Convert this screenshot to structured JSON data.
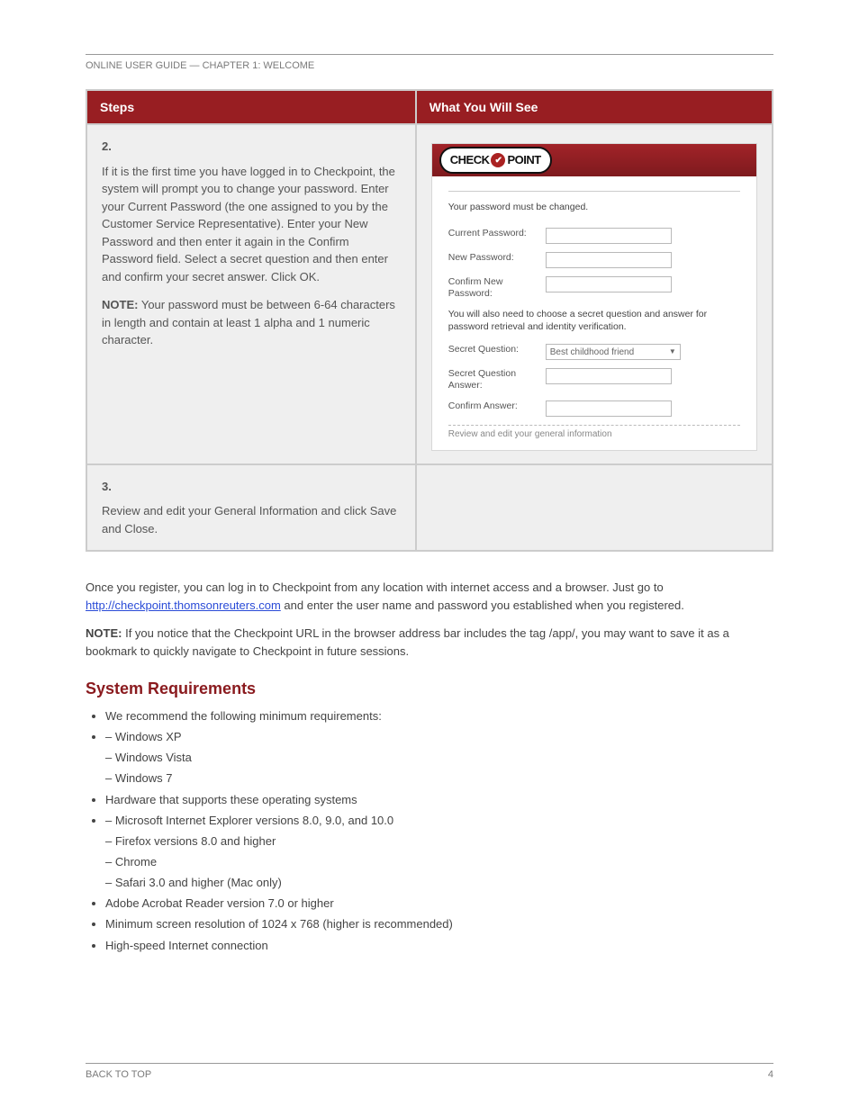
{
  "header_line": "ONLINE USER GUIDE — CHAPTER 1: WELCOME",
  "table": {
    "cols": [
      "Steps",
      "What You Will See"
    ],
    "row1": {
      "num": "2.",
      "text": "If it is the first time you have logged in to Checkpoint, the system will prompt you to change your password. Enter your Current Password (the one assigned to you by the Customer Service Representative). Enter your New Password and then enter it again in the Confirm Password field. Select a secret question and then enter and confirm your secret answer. Click OK.",
      "note_label": "NOTE:",
      "note_text": "Your password must be between 6-64 characters in length and contain at least 1 alpha and 1 numeric character."
    },
    "row2": {
      "num": "3.",
      "text": "Review and edit your General Information and click Save and Close."
    },
    "screenshot": {
      "brand_check": "CHECK",
      "brand_point": "POINT",
      "msg": "Your password must be changed.",
      "labels": {
        "current": "Current Password:",
        "newp": "New Password:",
        "confirm": "Confirm New Password:",
        "info": "You will also need to choose a secret question and answer for password retrieval and identity verification.",
        "secretq": "Secret Question:",
        "secreta": "Secret Question Answer:",
        "confirma": "Confirm Answer:"
      },
      "select_value": "Best childhood friend",
      "tear_text": "Review and edit your general information"
    }
  },
  "body": {
    "p1_a": "Once you register, you can log in to Checkpoint from any location with internet access and a browser. Just go to ",
    "p1_link": "http://checkpoint.thomsonreuters.com",
    "p1_b": " and enter the user name and password you established when you registered.",
    "p2_label": "NOTE:",
    "p2_text": "If you notice that the Checkpoint URL in the browser address bar includes the tag /app/, you may want to save it as a bookmark to quickly navigate to Checkpoint in future sessions."
  },
  "section_heading": "System Requirements",
  "bullets": {
    "intro": "We recommend the following minimum requirements:",
    "os": [
      "Windows XP",
      "Windows Vista",
      "Windows 7"
    ],
    "hw_label": "Hardware that supports these operating systems",
    "browsers": [
      "Microsoft Internet Explorer versions 8.0, 9.0, and 10.0",
      "Firefox versions 8.0 and higher",
      "Chrome",
      "Safari 3.0 and higher (Mac only)"
    ],
    "other": [
      "Adobe Acrobat Reader version 7.0 or higher",
      "Minimum screen resolution of 1024 x 768 (higher is recommended)",
      "High-speed Internet connection"
    ]
  },
  "footer": {
    "left": "BACK TO TOP",
    "right": "4"
  }
}
